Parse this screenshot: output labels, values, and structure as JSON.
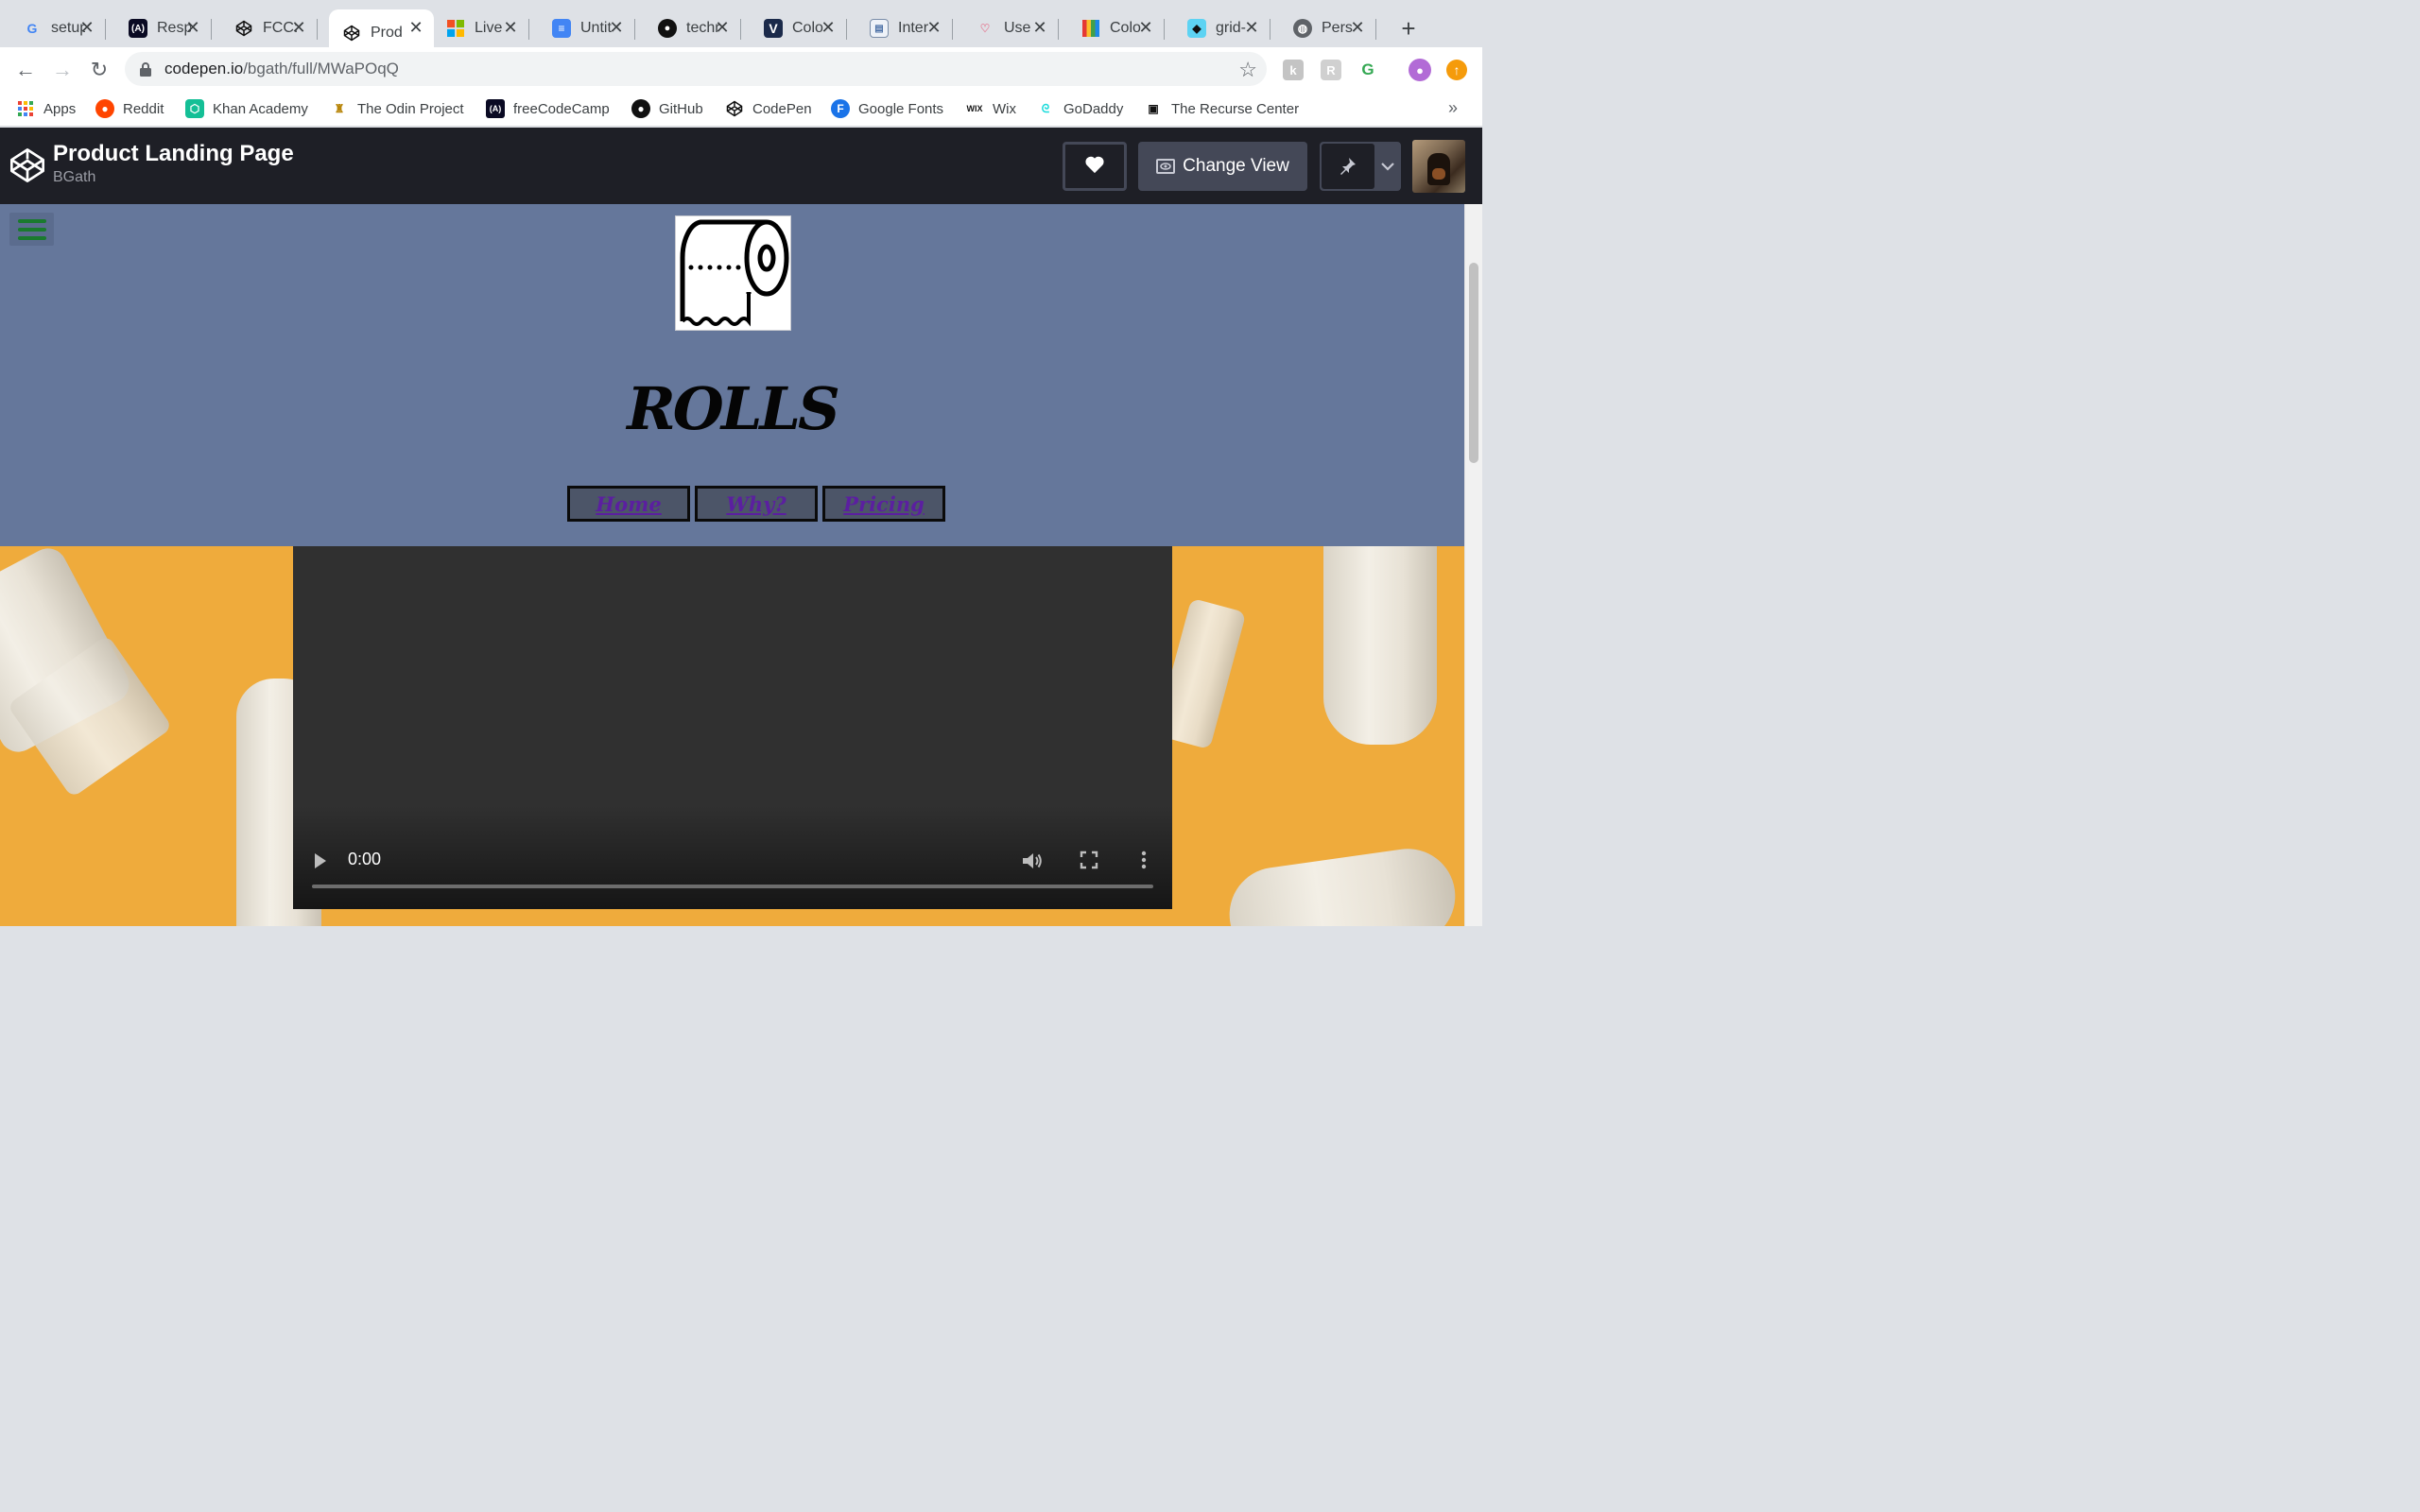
{
  "browser": {
    "tabs": [
      {
        "label": "setup",
        "icon": "google-icon",
        "active": false
      },
      {
        "label": "Resp",
        "icon": "freecodecamp-icon",
        "active": false
      },
      {
        "label": "FCC:",
        "icon": "codepen-icon",
        "active": false
      },
      {
        "label": "Prod",
        "icon": "codepen-icon",
        "active": true
      },
      {
        "label": "Live",
        "icon": "microsoft-icon",
        "active": false
      },
      {
        "label": "Untit",
        "icon": "google-docs-icon",
        "active": false
      },
      {
        "label": "techr",
        "icon": "github-icon",
        "active": false
      },
      {
        "label": "Colo",
        "icon": "v-icon",
        "active": false
      },
      {
        "label": "Inter",
        "icon": "document-icon",
        "active": false
      },
      {
        "label": "Use",
        "icon": "heart-icon",
        "active": false
      },
      {
        "label": "Colo",
        "icon": "color-palette-icon",
        "active": false
      },
      {
        "label": "grid-",
        "icon": "bird-icon",
        "active": false
      },
      {
        "label": "Pers",
        "icon": "globe-icon",
        "active": false
      }
    ],
    "new_tab": "+",
    "url": {
      "host": "codepen.io",
      "path": "/bgath/full/MWaPOqQ"
    },
    "bookmarks": [
      {
        "label": "Apps",
        "icon": "apps-grid-icon"
      },
      {
        "label": "Reddit",
        "icon": "reddit-icon"
      },
      {
        "label": "Khan Academy",
        "icon": "khan-academy-icon"
      },
      {
        "label": "The Odin Project",
        "icon": "odin-project-icon"
      },
      {
        "label": "freeCodeCamp",
        "icon": "freecodecamp-icon"
      },
      {
        "label": "GitHub",
        "icon": "github-icon"
      },
      {
        "label": "CodePen",
        "icon": "codepen-icon"
      },
      {
        "label": "Google Fonts",
        "icon": "google-fonts-icon"
      },
      {
        "label": "Wix",
        "icon": "wix-icon"
      },
      {
        "label": "GoDaddy",
        "icon": "godaddy-icon"
      },
      {
        "label": "The Recurse Center",
        "icon": "recurse-center-icon"
      }
    ],
    "bookmarks_overflow": "»"
  },
  "codepen": {
    "title": "Product Landing Page",
    "author": "BGath",
    "change_view_label": "Change View"
  },
  "page": {
    "brand": "ROLLS",
    "nav": [
      "Home",
      "Why?",
      "Pricing"
    ],
    "video": {
      "time": "0:00",
      "progress": 0
    }
  },
  "colors": {
    "hero_top": "#65779b",
    "hero_bottom": "#efab3c",
    "nav_link": "#5b1fa0",
    "hamburger": "#1a7a2e",
    "codepen_header": "#1e1f26"
  }
}
